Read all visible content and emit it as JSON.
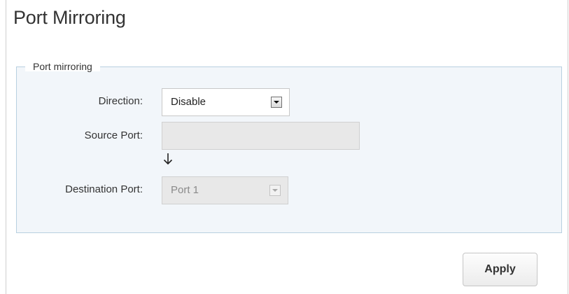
{
  "page": {
    "title": "Port Mirroring"
  },
  "section": {
    "legend": "Port mirroring",
    "direction": {
      "label": "Direction:",
      "value": "Disable"
    },
    "source_port": {
      "label": "Source Port:",
      "value": ""
    },
    "destination_port": {
      "label": "Destination Port:",
      "value": "Port 1"
    }
  },
  "actions": {
    "apply_label": "Apply"
  },
  "icons": {
    "flow_arrow": "arrow-down-icon",
    "dropdown": "chevron-down-icon"
  },
  "colors": {
    "panel_bg": "#f2f6fa",
    "panel_border": "#b8d0e0",
    "disabled_bg": "#e8e8e8"
  }
}
